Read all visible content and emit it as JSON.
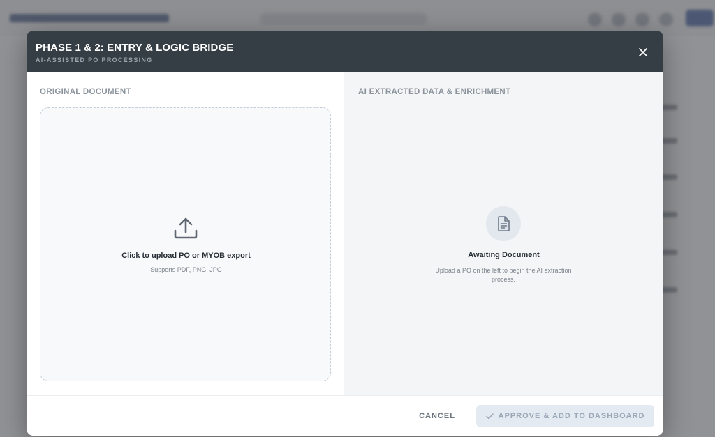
{
  "modal": {
    "title": "PHASE 1 & 2: ENTRY & LOGIC BRIDGE",
    "subtitle": "AI-ASSISTED PO PROCESSING",
    "close_icon": "close-icon"
  },
  "left_pane": {
    "heading": "ORIGINAL DOCUMENT",
    "upload": {
      "icon": "upload-icon",
      "title": "Click to upload PO or MYOB export",
      "subtitle": "Supports PDF, PNG, JPG"
    }
  },
  "right_pane": {
    "heading": "AI EXTRACTED DATA & ENRICHMENT",
    "empty_state": {
      "icon": "document-icon",
      "title": "Awaiting Document",
      "subtitle": "Upload a PO on the left to begin the AI extraction process."
    }
  },
  "footer": {
    "cancel_label": "CANCEL",
    "approve_label": "APPROVE & ADD TO DASHBOARD",
    "approve_icon": "check-icon",
    "approve_disabled": true
  },
  "colors": {
    "header_bg": "#353d45",
    "pane_heading": "#8b939c",
    "approve_bg_disabled": "#e4eaf2",
    "approve_text_disabled": "#9aa7b6"
  }
}
